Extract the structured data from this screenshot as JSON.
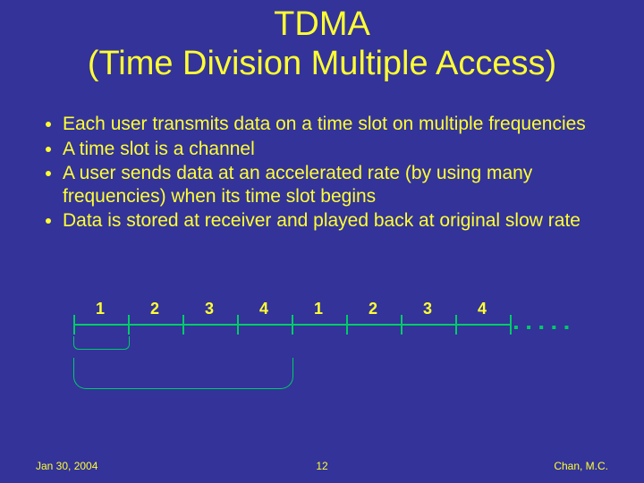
{
  "title": {
    "line1": "TDMA",
    "line2": "(Time Division Multiple Access)"
  },
  "bullets": [
    "Each user transmits data on a time slot on multiple frequencies",
    "A time slot is a channel",
    "A user sends data at an  accelerated rate (by using many frequencies) when its time slot begins",
    "Data is stored at receiver and played back at original slow rate"
  ],
  "timeline": {
    "slots": [
      "1",
      "2",
      "3",
      "4",
      "1",
      "2",
      "3",
      "4"
    ],
    "dots": "▪ ▪ ▪ ▪ ▪"
  },
  "footer": {
    "date": "Jan 30, 2004",
    "page": "12",
    "author": "Chan, M.C."
  },
  "colors": {
    "bg": "#33339a",
    "text": "#ffff33",
    "axis": "#00cc66"
  },
  "chart_data": {
    "type": "timeline",
    "description": "TDMA time slots cycling 1-4 repeated along a horizontal time axis; a brace groups one full cycle (slots 1-4); a smaller brace under slot 1 indicates the buffering of the first user's data.",
    "slots": [
      1,
      2,
      3,
      4,
      1,
      2,
      3,
      4
    ],
    "cycle_length": 4,
    "small_bracket_span": [
      1,
      1
    ],
    "large_bracket_span": [
      1,
      4
    ]
  }
}
